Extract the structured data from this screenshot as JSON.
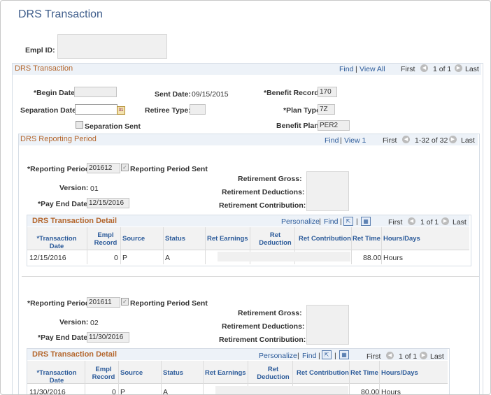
{
  "page": {
    "title": "DRS Transaction"
  },
  "empl": {
    "label": "Empl ID:",
    "value": ""
  },
  "drs": {
    "title": "DRS Transaction",
    "find": "Find",
    "sep": "|",
    "view_all": "View All",
    "first": "First",
    "count": "1 of 1",
    "last": "Last",
    "begin_date_label": "*Begin Date:",
    "begin_date": "",
    "sent_date_label": "Sent Date:",
    "sent_date": "09/15/2015",
    "benefit_record_label": "*Benefit Record:",
    "benefit_record": "170",
    "separation_date_label": "Separation Date:",
    "separation_date": "",
    "retiree_type_label": "Retiree Type:",
    "retiree_type": "",
    "plan_type_label": "*Plan Type",
    "plan_type": "7Z",
    "separation_sent_label": "Separation Sent",
    "benefit_plan_label": "Benefit Plan:",
    "benefit_plan": "PER2"
  },
  "reporting": {
    "title": "DRS Reporting Period",
    "find": "Find",
    "sep": "|",
    "view": "View 1",
    "first": "First",
    "count": "1-32 of 32",
    "last": "Last",
    "labels": {
      "period": "*Reporting Period:",
      "sent": "Reporting Period Sent",
      "version": "Version:",
      "pay_end": "*Pay End Date:",
      "gross": "Retirement Gross:",
      "deductions": "Retirement Deductions:",
      "contribution": "Retirement Contribution:"
    },
    "periods": [
      {
        "period": "201612",
        "version": "01",
        "pay_end": "12/15/2016",
        "detail": {
          "title": "DRS Transaction Detail",
          "personalize": "Personalize",
          "find": "Find",
          "first": "First",
          "count": "1 of 1",
          "last": "Last",
          "row": {
            "date": "12/15/2016",
            "rec": "0",
            "source": "P",
            "status": "A",
            "ret_time": "88.00",
            "hours": "Hours"
          }
        }
      },
      {
        "period": "201611",
        "version": "02",
        "pay_end": "11/30/2016",
        "detail": {
          "title": "DRS Transaction Detail",
          "personalize": "Personalize",
          "find": "Find",
          "first": "First",
          "count": "1 of 1",
          "last": "Last",
          "row": {
            "date": "11/30/2016",
            "rec": "0",
            "source": "P",
            "status": "A",
            "ret_time": "80.00",
            "hours": "Hours"
          }
        }
      }
    ],
    "columns": {
      "date": "*Transaction Date",
      "rec1": "Empl",
      "rec2": "Record",
      "source": "Source",
      "status": "Status",
      "earn": "Ret Earnings",
      "ded1": "Ret",
      "ded2": "Deduction",
      "contrib": "Ret Contribution",
      "time": "Ret Time",
      "hours": "Hours/Days"
    }
  }
}
